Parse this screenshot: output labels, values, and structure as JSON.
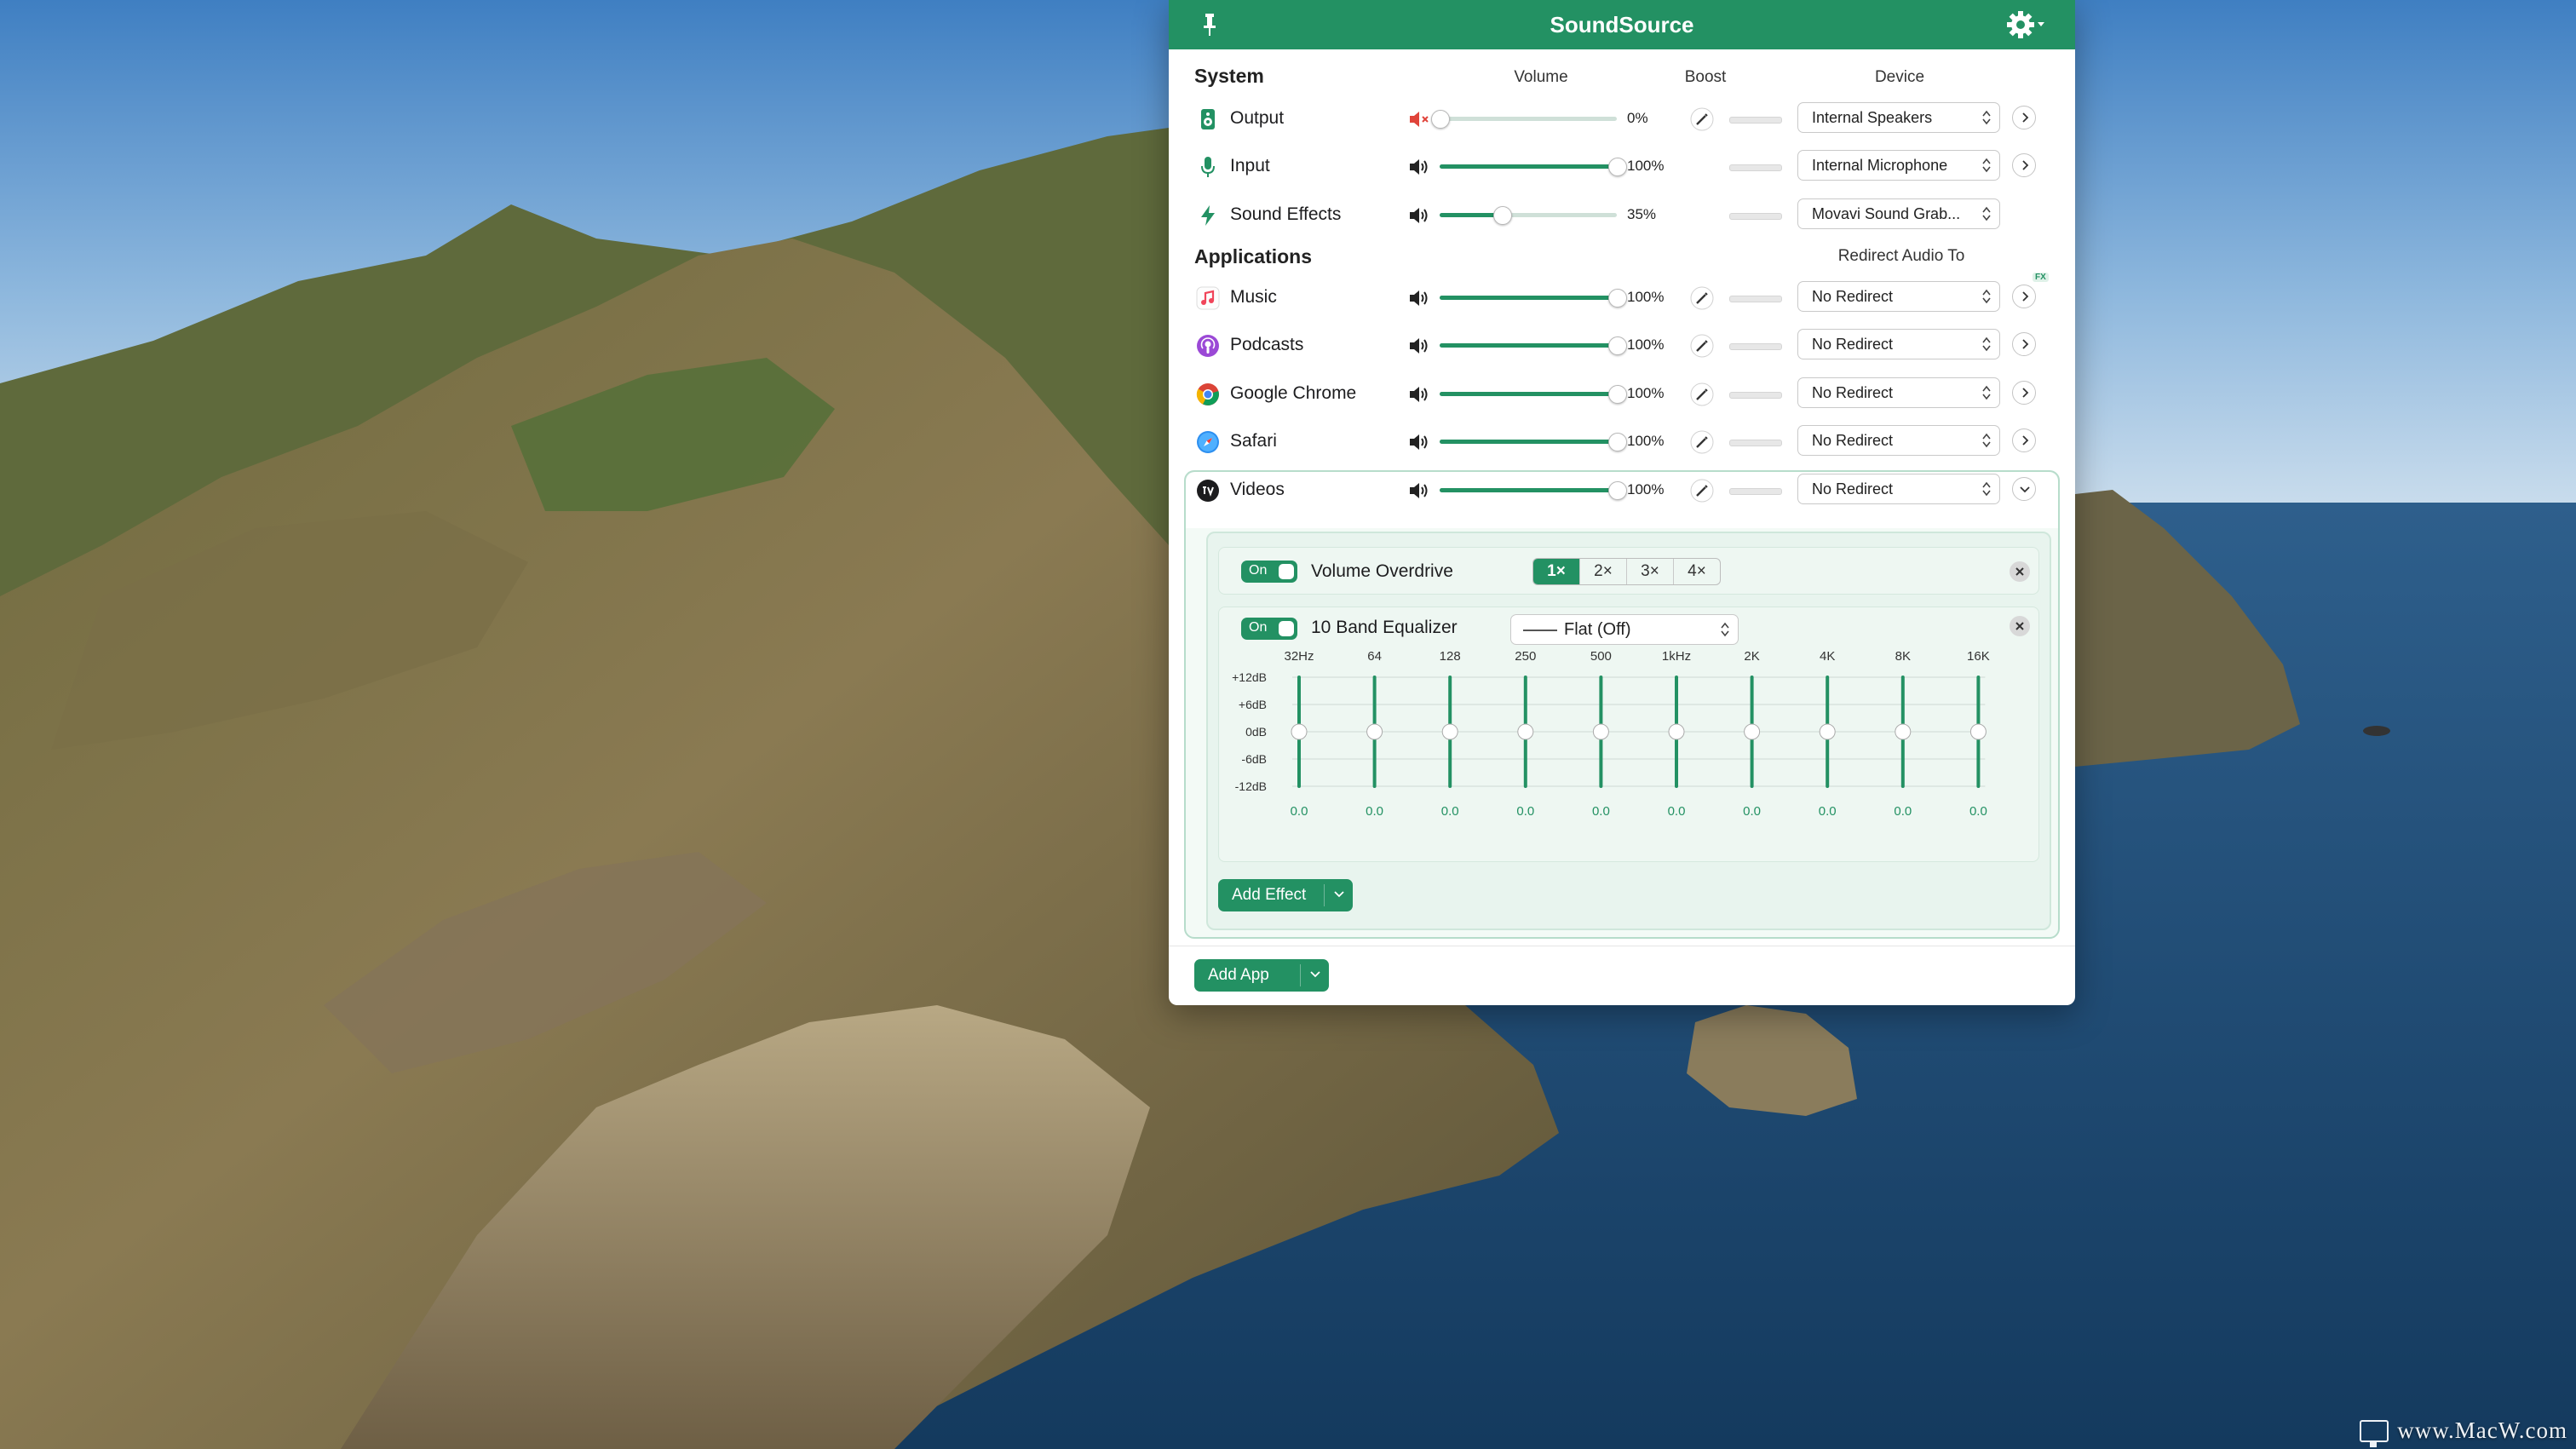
{
  "window": {
    "title": "SoundSource"
  },
  "columns": {
    "volume": "Volume",
    "boost": "Boost",
    "device": "Device",
    "redirect": "Redirect Audio To"
  },
  "system": {
    "heading": "System",
    "rows": [
      {
        "name": "Output",
        "icon": "speaker-device-icon",
        "volume": 0,
        "volume_label": "0%",
        "muted": true,
        "device": "Internal Speakers",
        "has_boost": true
      },
      {
        "name": "Input",
        "icon": "microphone-icon",
        "volume": 100,
        "volume_label": "100%",
        "muted": false,
        "device": "Internal Microphone",
        "has_boost": false
      },
      {
        "name": "Sound Effects",
        "icon": "lightning-icon",
        "volume": 35,
        "volume_label": "35%",
        "muted": false,
        "device": "Movavi Sound Grab...",
        "has_boost": false
      }
    ]
  },
  "applications": {
    "heading": "Applications",
    "rows": [
      {
        "name": "Music",
        "icon": "music-app-icon",
        "volume": 100,
        "volume_label": "100%",
        "redirect": "No Redirect",
        "fx_badge": "FX"
      },
      {
        "name": "Podcasts",
        "icon": "podcasts-app-icon",
        "volume": 100,
        "volume_label": "100%",
        "redirect": "No Redirect"
      },
      {
        "name": "Google Chrome",
        "icon": "chrome-app-icon",
        "volume": 100,
        "volume_label": "100%",
        "redirect": "No Redirect"
      },
      {
        "name": "Safari",
        "icon": "safari-app-icon",
        "volume": 100,
        "volume_label": "100%",
        "redirect": "No Redirect"
      },
      {
        "name": "Videos",
        "icon": "tv-app-icon",
        "volume": 100,
        "volume_label": "100%",
        "redirect": "No Redirect",
        "expanded": true
      }
    ]
  },
  "effects": {
    "overdrive": {
      "toggle": "On",
      "name": "Volume Overdrive",
      "options": [
        "1×",
        "2×",
        "3×",
        "4×"
      ],
      "selected": "1×"
    },
    "equalizer": {
      "toggle": "On",
      "name": "10 Band Equalizer",
      "preset": "Flat (Off)",
      "bands": [
        "32Hz",
        "64",
        "128",
        "250",
        "500",
        "1kHz",
        "2K",
        "4K",
        "8K",
        "16K"
      ],
      "db_labels": [
        "+12dB",
        "+6dB",
        "0dB",
        "-6dB",
        "-12dB"
      ],
      "gains": [
        0.0,
        0.0,
        0.0,
        0.0,
        0.0,
        0.0,
        0.0,
        0.0,
        0.0,
        0.0
      ],
      "gain_labels": [
        "0.0",
        "0.0",
        "0.0",
        "0.0",
        "0.0",
        "0.0",
        "0.0",
        "0.0",
        "0.0",
        "0.0"
      ]
    },
    "add_effect_label": "Add Effect"
  },
  "add_app_label": "Add App",
  "watermark": "www.MacW.com",
  "colors": {
    "accent": "#239163",
    "mute_red": "#e0443a"
  }
}
